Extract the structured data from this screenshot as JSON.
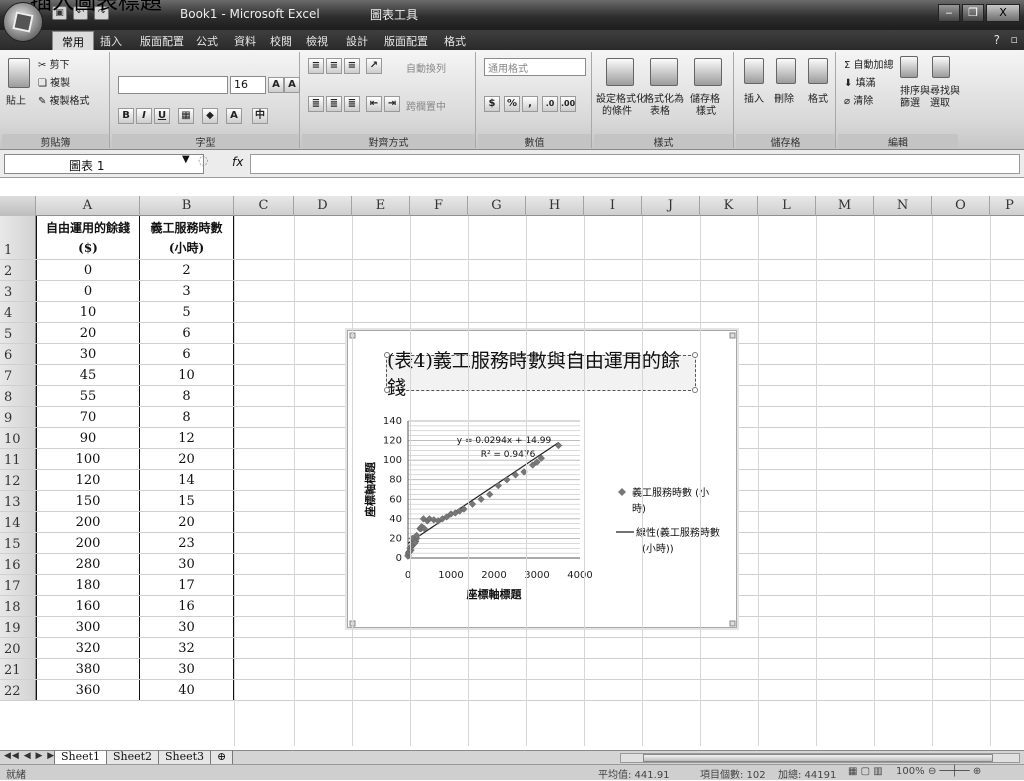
{
  "caption": "插入圖表標題",
  "window": {
    "title": "Book1 - Microsoft Excel",
    "contextual_tab": "圖表工具",
    "buttons": [
      "‒",
      "❐",
      "X"
    ]
  },
  "tabs": [
    "常用",
    "插入",
    "版面配置",
    "公式",
    "資料",
    "校閱",
    "檢視",
    "設計",
    "版面配置",
    "格式"
  ],
  "active_tab": "常用",
  "ribbon": {
    "clipboard": {
      "paste": "貼上",
      "cut": "剪下",
      "copy": "複製",
      "format_painter": "複製格式",
      "label": "剪貼簿"
    },
    "font": {
      "size": "16",
      "label": "字型",
      "bold": "B",
      "italic": "I",
      "underline": "U"
    },
    "alignment": {
      "wrap": "自動換列",
      "merge": "跨欄置中",
      "label": "對齊方式"
    },
    "number": {
      "format": "通用格式",
      "percent": "%",
      "comma": ",",
      "inc": ".0",
      "dec": ".00",
      "label": "數值"
    },
    "styles": {
      "conditional": [
        "設定格式化",
        "的條件"
      ],
      "as_table": [
        "格式化為",
        "表格"
      ],
      "cell_styles": [
        "儲存格",
        "樣式"
      ],
      "label": "樣式"
    },
    "cells": {
      "insert": "插入",
      "delete": "刪除",
      "format": "格式",
      "label": "儲存格"
    },
    "editing": {
      "autosum": "自動加總",
      "fill": "填滿",
      "clear": "清除",
      "sort": [
        "排序與",
        "篩選"
      ],
      "find": [
        "尋找與",
        "選取"
      ],
      "label": "編輯"
    }
  },
  "formula_bar": {
    "name_box": "圖表 1",
    "fx": "fx"
  },
  "columns": [
    "A",
    "B",
    "C",
    "D",
    "E",
    "F",
    "G",
    "H",
    "I",
    "J",
    "K",
    "L",
    "M",
    "N",
    "O",
    "P"
  ],
  "table": {
    "header_a": [
      "自由運用的餘錢",
      "($)"
    ],
    "header_b": [
      "義工服務時數",
      "(小時)"
    ],
    "rows": [
      [
        "0",
        "2"
      ],
      [
        "0",
        "3"
      ],
      [
        "10",
        "5"
      ],
      [
        "20",
        "6"
      ],
      [
        "30",
        "6"
      ],
      [
        "45",
        "10"
      ],
      [
        "55",
        "8"
      ],
      [
        "70",
        "8"
      ],
      [
        "90",
        "12"
      ],
      [
        "100",
        "20"
      ],
      [
        "120",
        "14"
      ],
      [
        "150",
        "15"
      ],
      [
        "200",
        "20"
      ],
      [
        "200",
        "23"
      ],
      [
        "280",
        "30"
      ],
      [
        "180",
        "17"
      ],
      [
        "160",
        "16"
      ],
      [
        "300",
        "30"
      ],
      [
        "320",
        "32"
      ],
      [
        "380",
        "30"
      ],
      [
        "360",
        "40"
      ]
    ]
  },
  "chart_data": {
    "type": "scatter",
    "title": "(表4)義工服務時數與自由運用的餘錢",
    "xlabel": "座標軸標題",
    "ylabel": "座標軸標題",
    "xlim": [
      0,
      4000
    ],
    "ylim": [
      0,
      140
    ],
    "x_ticks": [
      "0",
      "1000",
      "2000",
      "3000",
      "4000"
    ],
    "y_ticks": [
      "0",
      "20",
      "40",
      "60",
      "80",
      "100",
      "120",
      "140"
    ],
    "grid": true,
    "legend_position": "right",
    "series": [
      {
        "name": "義工服務時數(小時)",
        "points": [
          [
            0,
            2
          ],
          [
            0,
            3
          ],
          [
            10,
            5
          ],
          [
            20,
            6
          ],
          [
            30,
            6
          ],
          [
            45,
            10
          ],
          [
            55,
            8
          ],
          [
            70,
            8
          ],
          [
            90,
            12
          ],
          [
            100,
            20
          ],
          [
            120,
            14
          ],
          [
            150,
            15
          ],
          [
            200,
            20
          ],
          [
            200,
            23
          ],
          [
            280,
            30
          ],
          [
            180,
            17
          ],
          [
            160,
            16
          ],
          [
            300,
            30
          ],
          [
            320,
            32
          ],
          [
            380,
            30
          ],
          [
            360,
            40
          ],
          [
            450,
            38
          ],
          [
            500,
            40
          ],
          [
            600,
            39
          ],
          [
            700,
            38
          ],
          [
            800,
            40
          ],
          [
            900,
            42
          ],
          [
            1000,
            45
          ],
          [
            1100,
            46
          ],
          [
            1200,
            48
          ],
          [
            1300,
            50
          ],
          [
            1500,
            55
          ],
          [
            1700,
            60
          ],
          [
            1900,
            65
          ],
          [
            2100,
            74
          ],
          [
            2300,
            80
          ],
          [
            2500,
            85
          ],
          [
            2700,
            88
          ],
          [
            2900,
            95
          ],
          [
            3000,
            98
          ],
          [
            3100,
            102
          ],
          [
            3500,
            115
          ]
        ]
      }
    ],
    "trendline": {
      "name": "線性(義工服務時數(小時))",
      "slope": 0.0294,
      "intercept": 14.99,
      "equation": "y = 0.0294x + 14.99",
      "r_squared": "R² = 0.9476"
    },
    "legend": {
      "marker_label": [
        "義工服務時數 (小",
        "時)"
      ],
      "line_label": [
        "線性(義工服務時數",
        "(小時))"
      ]
    }
  },
  "sheets": [
    "Sheet1",
    "Sheet2",
    "Sheet3"
  ],
  "status": {
    "ready": "就緒",
    "average": "平均值: 441.91",
    "count": "項目個數: 102",
    "sum": "加總: 44191",
    "zoom": "100%"
  },
  "colors": {
    "marker": "#777777",
    "grid": "#b5b5b5"
  }
}
